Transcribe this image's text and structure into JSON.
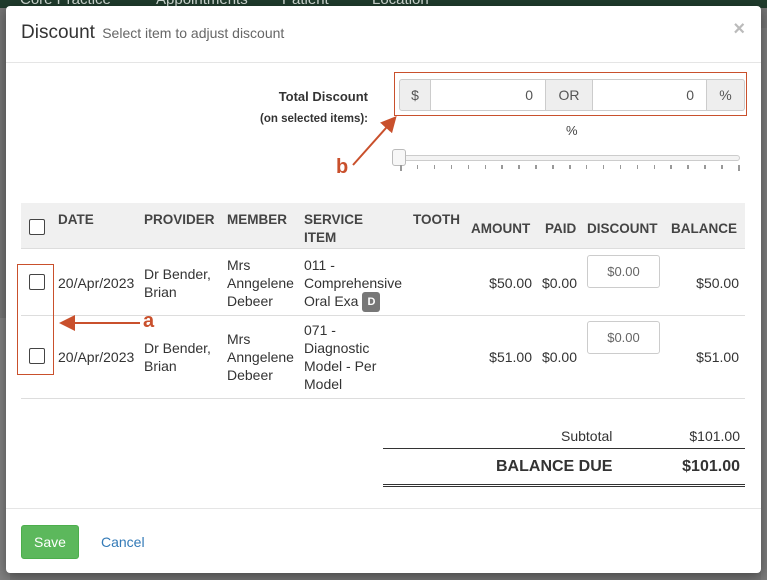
{
  "background": {
    "nav_items": [
      "Core Practice",
      "Appointments",
      "Patient",
      "Location"
    ]
  },
  "modal": {
    "title": "Discount",
    "subtitle": "Select item to adjust discount",
    "close": "×"
  },
  "total_discount": {
    "label": "Total Discount",
    "sublabel": "(on selected items):",
    "dollar_addon": "$",
    "dollar_value": "0",
    "or_label": "OR",
    "percent_value": "0",
    "percent_addon": "%",
    "slider_label": "%",
    "slider_value": 0
  },
  "annotations": {
    "a": "a",
    "b": "b"
  },
  "table": {
    "headers": {
      "date": "DATE",
      "provider": "PROVIDER",
      "member": "MEMBER",
      "service_line1": "SERVICE",
      "service_line2": "ITEM",
      "tooth": "TOOTH",
      "amount": "AMOUNT",
      "paid": "PAID",
      "discount": "DISCOUNT",
      "balance": "BALANCE"
    },
    "rows": [
      {
        "date": "20/Apr/2023",
        "provider_1": "Dr Bender,",
        "provider_2": "Brian",
        "member_1": "Mrs",
        "member_2": "Anngelene",
        "member_3": "Debeer",
        "service_1": "011 -",
        "service_2": "Comprehensive",
        "service_3": "Oral Exa",
        "badge": "D",
        "amount": "$50.00",
        "paid": "$0.00",
        "discount": "$0.00",
        "balance": "$50.00"
      },
      {
        "date": "20/Apr/2023",
        "provider_1": "Dr Bender,",
        "provider_2": "Brian",
        "member_1": "Mrs",
        "member_2": "Anngelene",
        "member_3": "Debeer",
        "service_1": "071 -",
        "service_2": "Diagnostic",
        "service_3": "Model - Per",
        "service_4": "Model",
        "amount": "$51.00",
        "paid": "$0.00",
        "discount": "$0.00",
        "balance": "$51.00"
      }
    ]
  },
  "totals": {
    "subtotal_label": "Subtotal",
    "subtotal_value": "$101.00",
    "balance_label": "BALANCE DUE",
    "balance_value": "$101.00"
  },
  "footer": {
    "save_label": "Save",
    "cancel_label": "Cancel"
  },
  "colors": {
    "annotation": "#c9502c",
    "save_button": "#5cb85c",
    "link": "#337ab7"
  }
}
